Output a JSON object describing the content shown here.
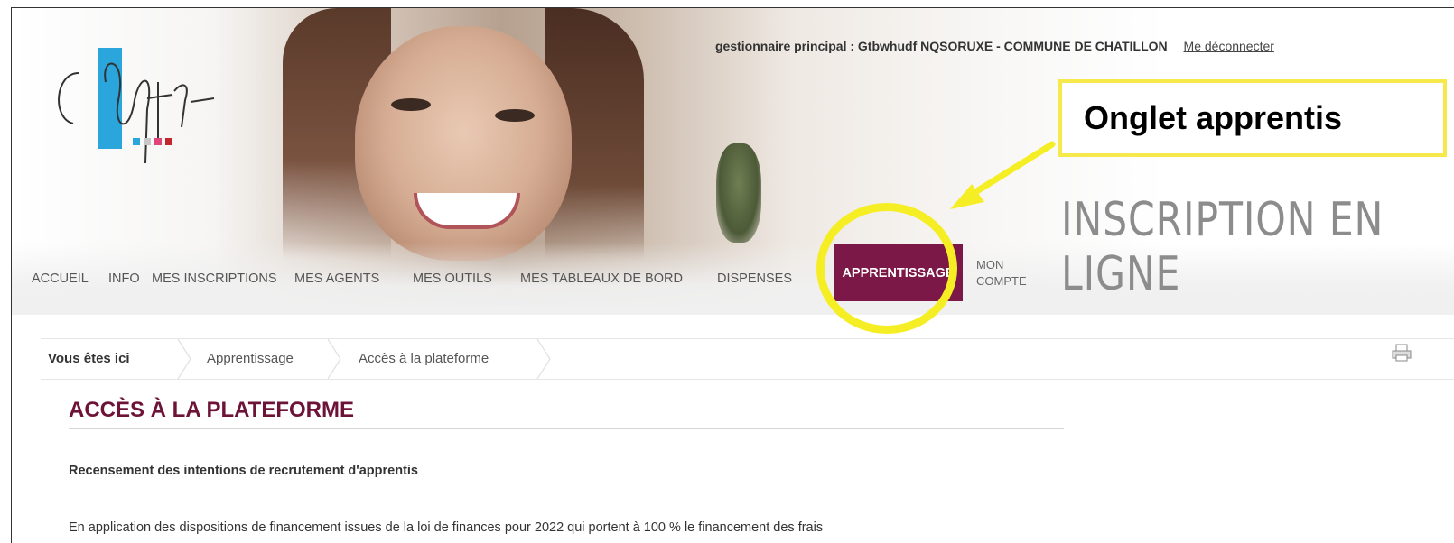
{
  "header": {
    "user_label": "gestionnaire principal : Gtbwhudf NQSORUXE - COMMUNE DE CHATILLON",
    "logout_label": "Me déconnecter",
    "tagline": "INSCRIPTION EN LIGNE"
  },
  "nav": {
    "items": [
      "ACCUEIL",
      "INFO",
      "MES INSCRIPTIONS",
      "MES AGENTS",
      "MES OUTILS",
      "MES TABLEAUX DE BORD",
      "DISPENSES",
      "APPRENTISSAGE"
    ],
    "mon": "MON",
    "compte": "COMPTE",
    "active": "APPRENTISSAGE"
  },
  "breadcrumb": {
    "items": [
      "Vous êtes ici",
      "Apprentissage",
      "Accès à la plateforme"
    ]
  },
  "main": {
    "title": "ACCÈS À LA PLATEFORME",
    "subtitle": "Recensement des intentions de recrutement d'apprentis",
    "paragraph": "En application des dispositions de financement issues de la loi de finances pour 2022 qui portent à 100 % le financement des frais"
  },
  "annotation": {
    "callout": "Onglet apprentis",
    "color": "#f5ee25"
  },
  "colors": {
    "accent": "#7b1848",
    "title": "#6e1338"
  }
}
